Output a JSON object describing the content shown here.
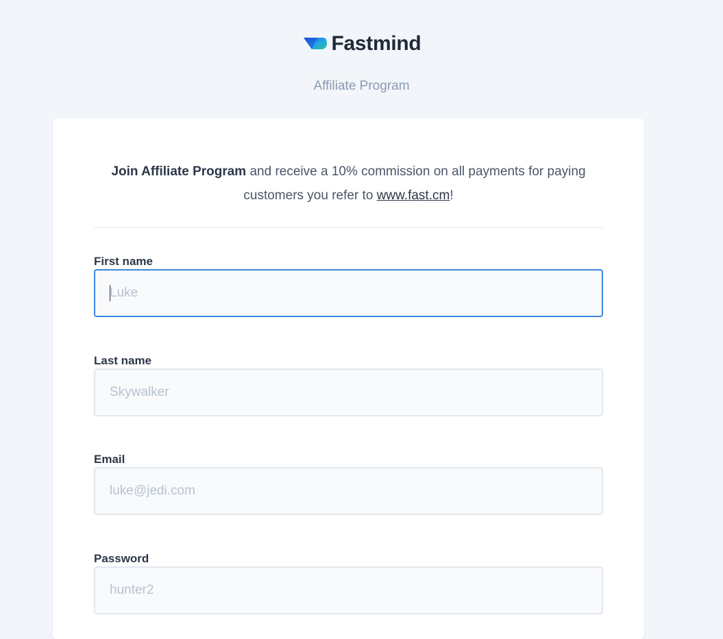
{
  "brand": {
    "name": "Fastmind",
    "subtitle": "Affiliate Program",
    "logo_colors": [
      "#1e4fd8",
      "#2fbf9f"
    ]
  },
  "intro": {
    "bold": "Join Affiliate Program",
    "text_before_link": " and receive a 10% commission on all payments for paying customers you refer to ",
    "link": "www.fast.cm",
    "text_after_link": "!"
  },
  "form": {
    "first_name": {
      "label": "First name",
      "placeholder": "Luke",
      "value": ""
    },
    "last_name": {
      "label": "Last name",
      "placeholder": "Skywalker",
      "value": ""
    },
    "email": {
      "label": "Email",
      "placeholder": "luke@jedi.com",
      "value": ""
    },
    "password": {
      "label": "Password",
      "placeholder": "hunter2",
      "value": ""
    }
  },
  "colors": {
    "background": "#f2f5f9",
    "focus_border": "#3b86e0",
    "muted_text": "#8b9bb4"
  }
}
